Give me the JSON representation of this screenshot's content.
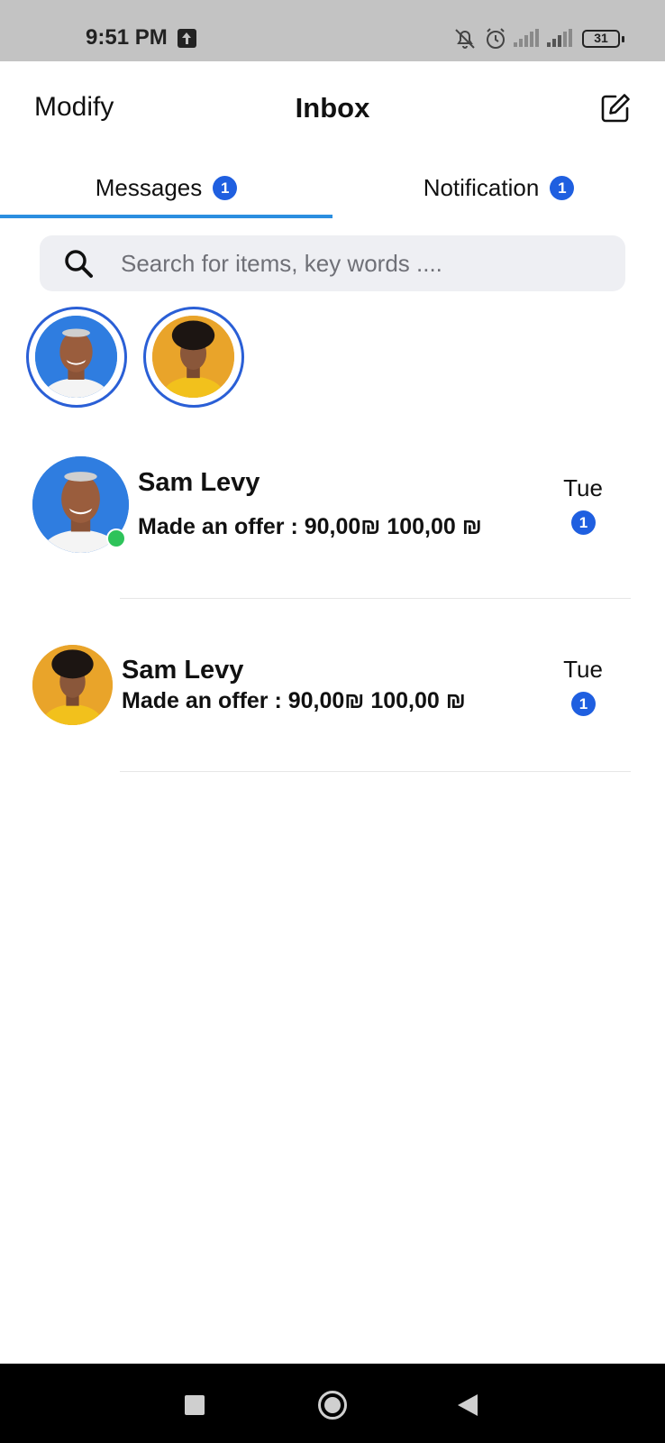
{
  "status_bar": {
    "time": "9:51 PM",
    "battery": "31",
    "icons": [
      "upload-icon",
      "mute-icon",
      "alarm-icon",
      "signal-icon",
      "signal-icon",
      "battery-icon"
    ]
  },
  "header": {
    "modify_label": "Modify",
    "title": "Inbox",
    "compose_icon": "compose-icon"
  },
  "tabs": [
    {
      "label": "Messages",
      "badge": "1",
      "active": true
    },
    {
      "label": "Notification",
      "badge": "1",
      "active": false
    }
  ],
  "search": {
    "placeholder": "Search for items, key words ....",
    "value": ""
  },
  "stories": [
    {
      "avatar": "avatar-older-man"
    },
    {
      "avatar": "avatar-young-man"
    }
  ],
  "conversations": [
    {
      "name": "Sam Levy",
      "preview": "Made an offer : 90,00₪  100,00 ₪",
      "time": "Tue",
      "unread": "1",
      "online": true
    },
    {
      "name": "Sam Levy",
      "preview": "Made an offer : 90,00₪  100,00 ₪",
      "time": "Tue",
      "unread": "1",
      "online": false
    }
  ],
  "colors": {
    "accent": "#1f5fe0",
    "tab_indicator": "#2b8ee0",
    "online": "#2ec35a",
    "status_bar": "#c3c3c3"
  }
}
